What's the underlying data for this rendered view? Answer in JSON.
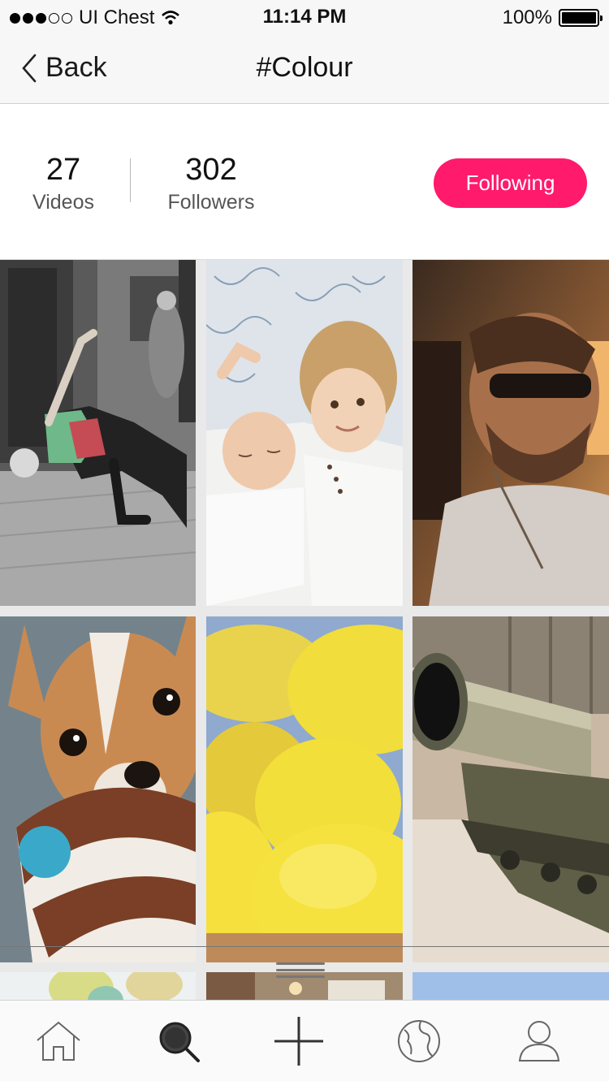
{
  "status_bar": {
    "carrier": "UI Chest",
    "time": "11:14 PM",
    "battery": "100%",
    "signal_dots_filled": 3,
    "signal_dots_total": 5,
    "icons": [
      "wifi-icon",
      "battery-icon"
    ]
  },
  "nav": {
    "back_label": "Back",
    "title": "#Colour"
  },
  "stats": {
    "videos_count": "27",
    "videos_label": "Videos",
    "followers_count": "302",
    "followers_label": "Followers",
    "follow_button_label": "Following"
  },
  "colors": {
    "accent": "#ff1a6c",
    "bar_bg": "#f7f7f7",
    "text": "#111111",
    "muted": "#555555"
  },
  "grid": {
    "tiles": [
      {
        "name": "breakdancer-photo"
      },
      {
        "name": "children-photo"
      },
      {
        "name": "man-sunglasses-photo"
      },
      {
        "name": "puppy-photo"
      },
      {
        "name": "lemons-photo"
      },
      {
        "name": "tank-photo"
      },
      {
        "name": "balloons-photo"
      },
      {
        "name": "interior-photo"
      },
      {
        "name": "sky-photo"
      }
    ]
  },
  "tab_bar": {
    "items": [
      {
        "name": "home-icon"
      },
      {
        "name": "search-icon"
      },
      {
        "name": "add-icon"
      },
      {
        "name": "globe-icon"
      },
      {
        "name": "profile-icon"
      }
    ]
  }
}
